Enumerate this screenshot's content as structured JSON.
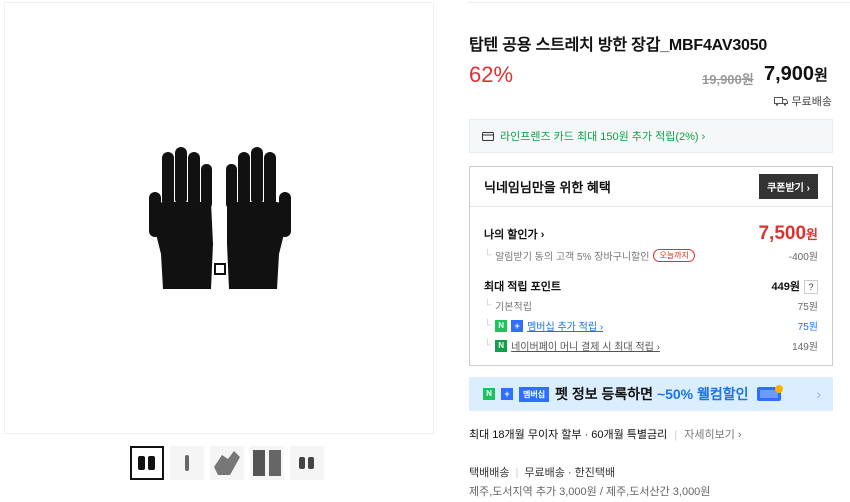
{
  "product": {
    "title": "탑텐 공용 스트레치 방한 장갑_MBF4AV3050",
    "discount": "62%",
    "original_price": "19,900원",
    "sale_price_num": "7,900",
    "sale_price_unit": "원",
    "shipping": "무료배송",
    "card_benefit": "라인프렌즈 카드 최대 150원 추가 적립(2%) ›"
  },
  "benefit": {
    "title": "닉네임님만을 위한 혜택",
    "coupon_button": "쿠폰받기 ›",
    "my_price_label": "나의 할인가 ›",
    "my_price_num": "7,500",
    "my_price_unit": "원",
    "alarm_label": "알림받기 동의 고객 5% 장바구니할인",
    "alarm_badge": "오늘까지",
    "alarm_value": "-400원",
    "points_label": "최대 적립 포인트",
    "points_value": "449원",
    "points_help": "?",
    "basic_label": "기본적립",
    "basic_value": "75원",
    "membership_label": "멤버십 추가 적립 ›",
    "membership_value": "75원",
    "npay_label": "네이버페이 머니 결제 시 최대 적립 ›",
    "npay_value": "149원"
  },
  "pet_banner": {
    "badge": "멤버십",
    "text_pre": "펫 정보 등록하면",
    "text_hl": "~50% 웰컴할인",
    "arrow": "›"
  },
  "installment": {
    "text": "최대 18개월 무이자 할부 · 60개월 특별금리",
    "more": "자세히보기 ›"
  },
  "delivery": {
    "method": "택배배송",
    "fee": "무료배송",
    "carrier": "· 한진택배",
    "extra": "제주,도서지역 추가 3,000원 / 제주,도서산간 3,000원"
  },
  "colors": {
    "accent_red": "#e03131",
    "accent_green": "#0fa048",
    "accent_blue": "#1a73e8"
  }
}
